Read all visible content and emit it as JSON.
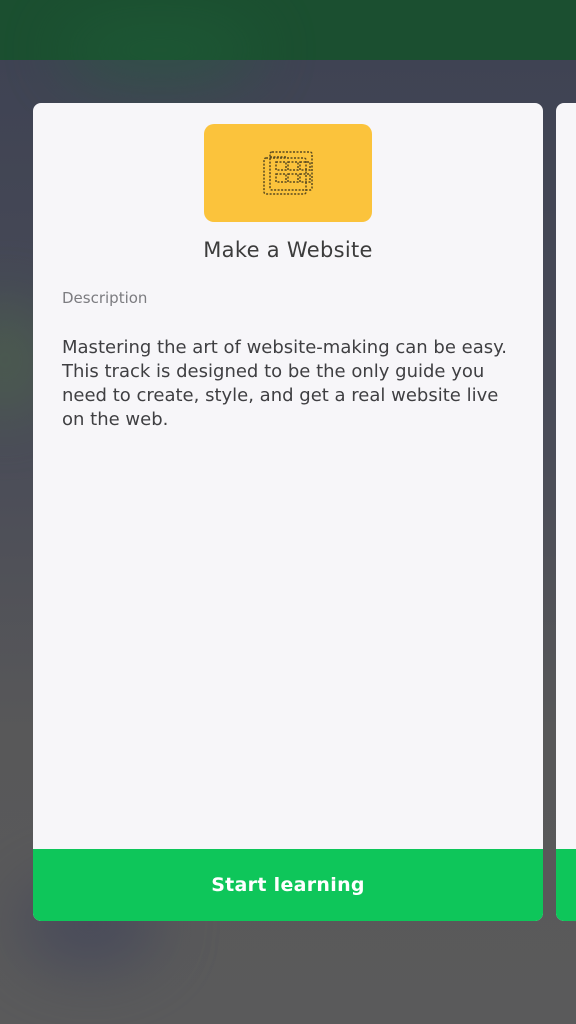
{
  "track_card": {
    "icon": "website-grid-icon",
    "title": "Make a Website",
    "description_label": "Description",
    "description": "Mastering the art of website-making can be easy. This track is designed to be the only guide you need to create, style, and get a real website live on the web.",
    "cta_label": "Start learning"
  },
  "colors": {
    "hero_background": "#fbc33c",
    "cta_background": "#0ec65a",
    "card_background": "#f7f6f9",
    "status_bar": "#1b4f30"
  }
}
